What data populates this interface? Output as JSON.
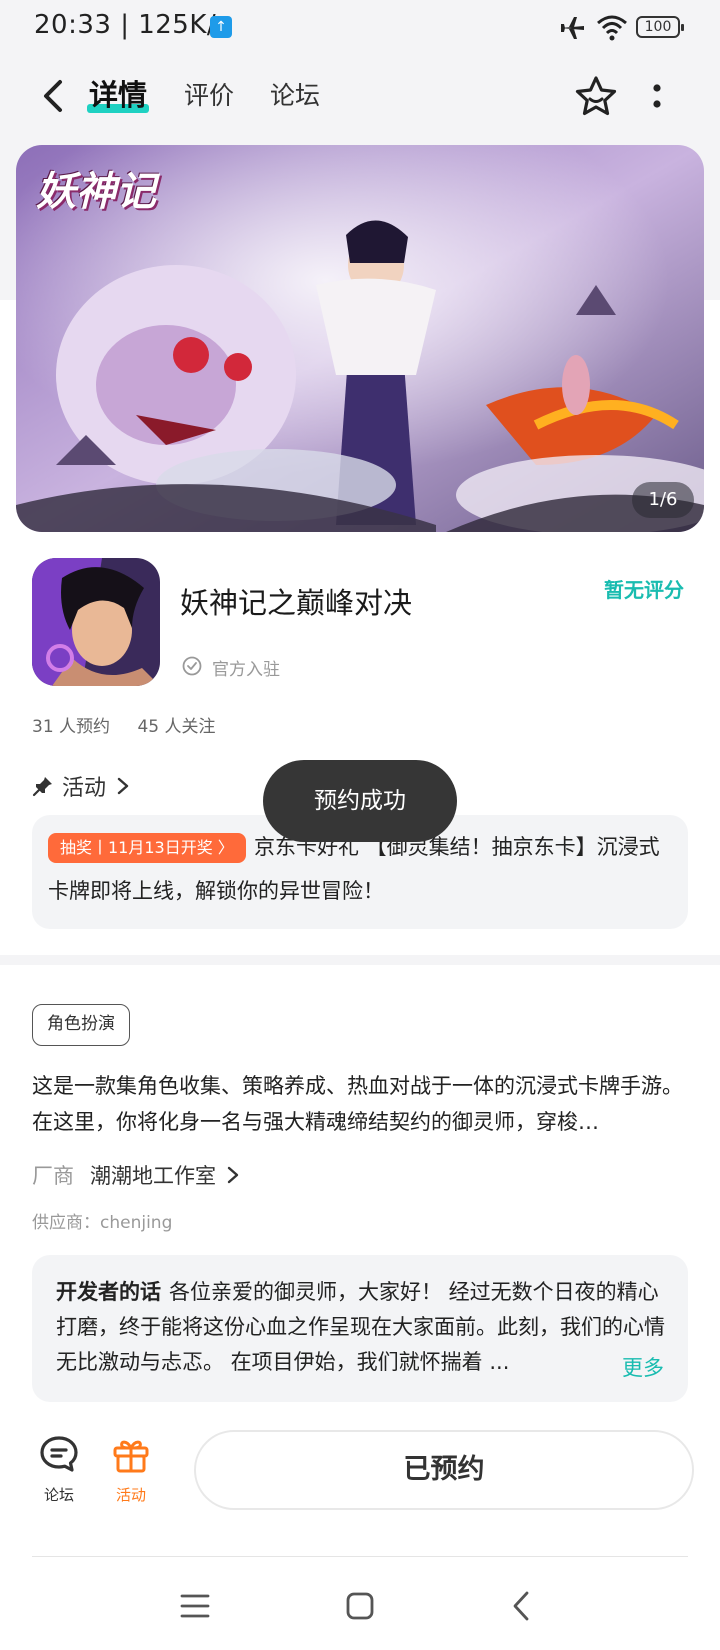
{
  "status_bar": {
    "time": "20:33 | 125K/s",
    "upload_icon": "upload-badge-icon",
    "battery": "100"
  },
  "nav": {
    "tabs": [
      {
        "label": "详情",
        "active": true
      },
      {
        "label": "评价",
        "active": false
      },
      {
        "label": "论坛",
        "active": false
      }
    ],
    "accent_color": "#1fd1c2"
  },
  "banner": {
    "logo_text": "妖神记",
    "counter": "1/6"
  },
  "app": {
    "title": "妖神记之巅峰对决",
    "rating": "暂无评分",
    "official": "官方入驻",
    "reservations": "31 人预约",
    "followers": "45 人关注"
  },
  "activity": {
    "section_label": "活动",
    "tag": "抽奖丨11月13日开奖 〉",
    "text": "京东卡好礼 【御灵集结！抽京东卡】沉浸式卡牌即将上线，解锁你的异世冒险！"
  },
  "toast": "预约成功",
  "details": {
    "genre": "角色扮演",
    "description": "这是一款集角色收集、策略养成、热血对战于一体的沉浸式卡牌手游。在这里，你将化身一名与强大精魂缔结契约的御灵师，穿梭…",
    "vendor_key": "厂商",
    "vendor_value": "潮潮地工作室",
    "supplier": "供应商：chenjing"
  },
  "developer": {
    "title": "开发者的话",
    "text": "各位亲爱的御灵师，大家好！ 经过无数个日夜的精心打磨，终于能将这份心血之作呈现在大家面前。此刻，我们的心情无比激动与忐忑。 在项目伊始，我们就怀揣着 ...",
    "more": "更多"
  },
  "bottom": {
    "forum_label": "论坛",
    "activity_label": "活动",
    "reserve_label": "已预约",
    "activity_color": "#ff7a1a"
  }
}
